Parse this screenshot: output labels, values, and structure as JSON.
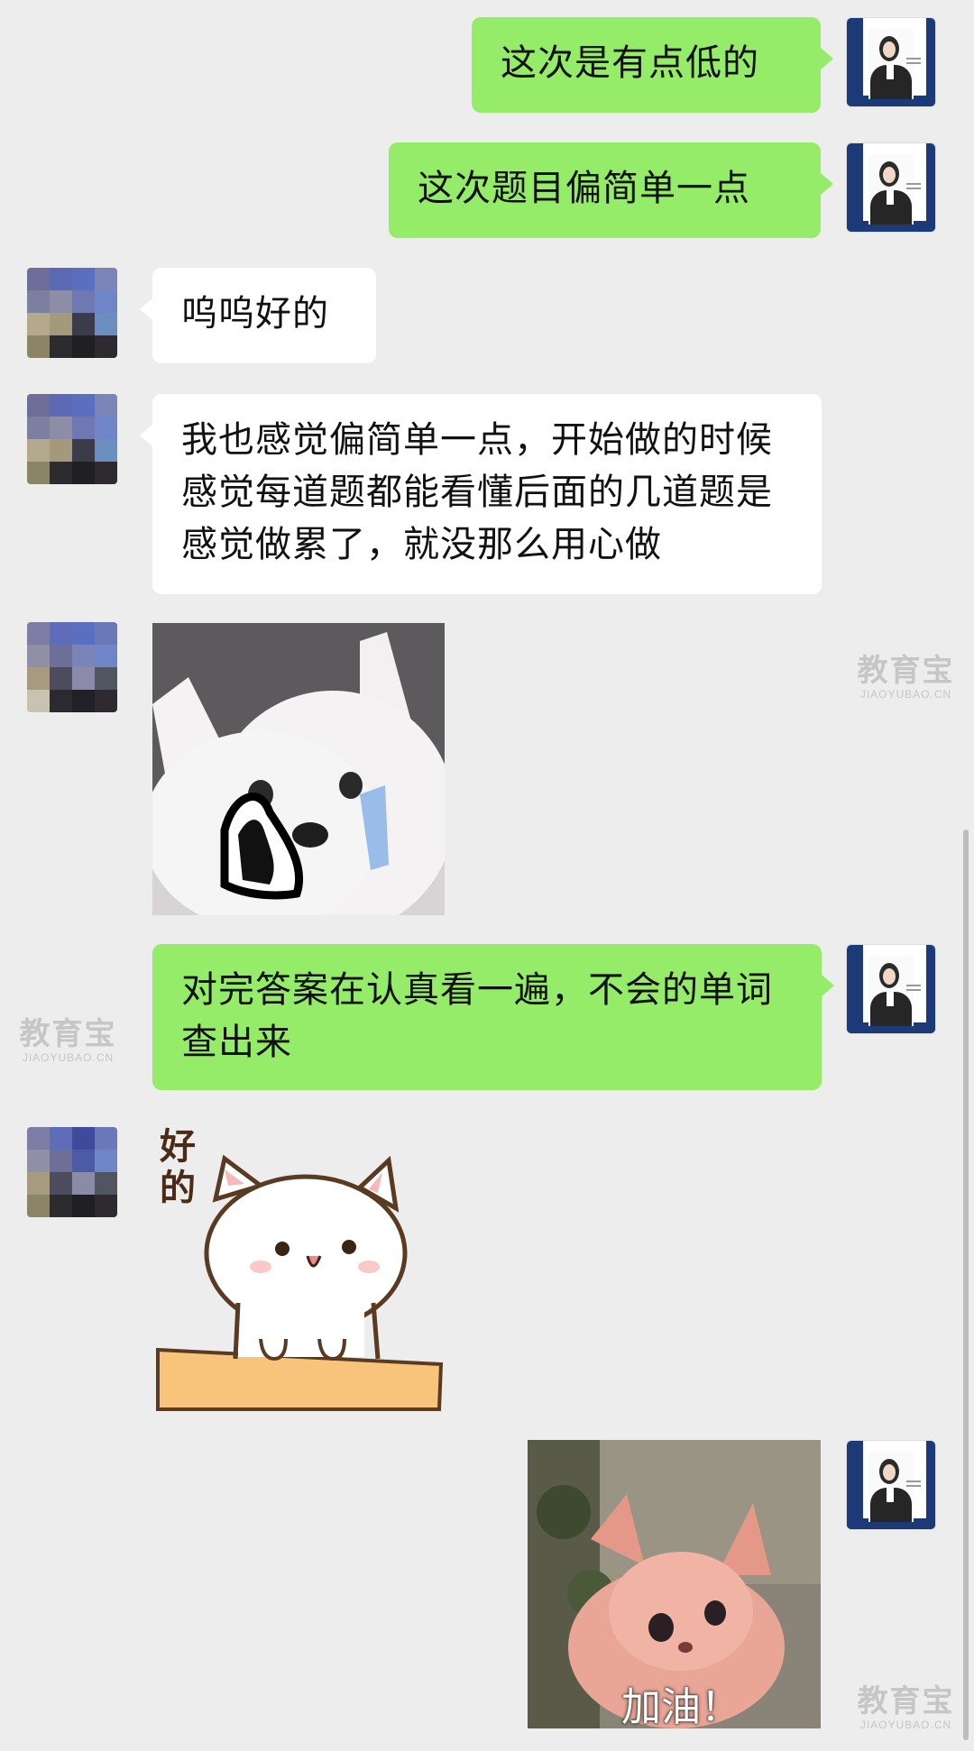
{
  "messages": [
    {
      "sender": "me",
      "text": "这次是有点低的"
    },
    {
      "sender": "me",
      "text": "这次题目偏简单一点"
    },
    {
      "sender": "them",
      "text": "呜呜好的"
    },
    {
      "sender": "them",
      "text": "我也感觉偏简单一点，开始做的时候感觉每道题都能看懂后面的几道题是感觉做累了，就没那么用心做"
    },
    {
      "sender": "them",
      "sticker": "crying-dog-sticker"
    },
    {
      "sender": "me",
      "text": "对完答案在认真看一遍，不会的单词查出来"
    },
    {
      "sender": "them",
      "sticker": "cat-ok-sticker",
      "sticker_text": "好的"
    },
    {
      "sender": "me",
      "sticker": "cheer-fox-sticker",
      "sticker_text": "加油！"
    }
  ],
  "watermark": {
    "main": "教育宝",
    "sub": "JIAOYUBAO.CN"
  },
  "colors": {
    "background": "#ededed",
    "my_bubble": "#95ec69",
    "their_bubble": "#ffffff"
  }
}
